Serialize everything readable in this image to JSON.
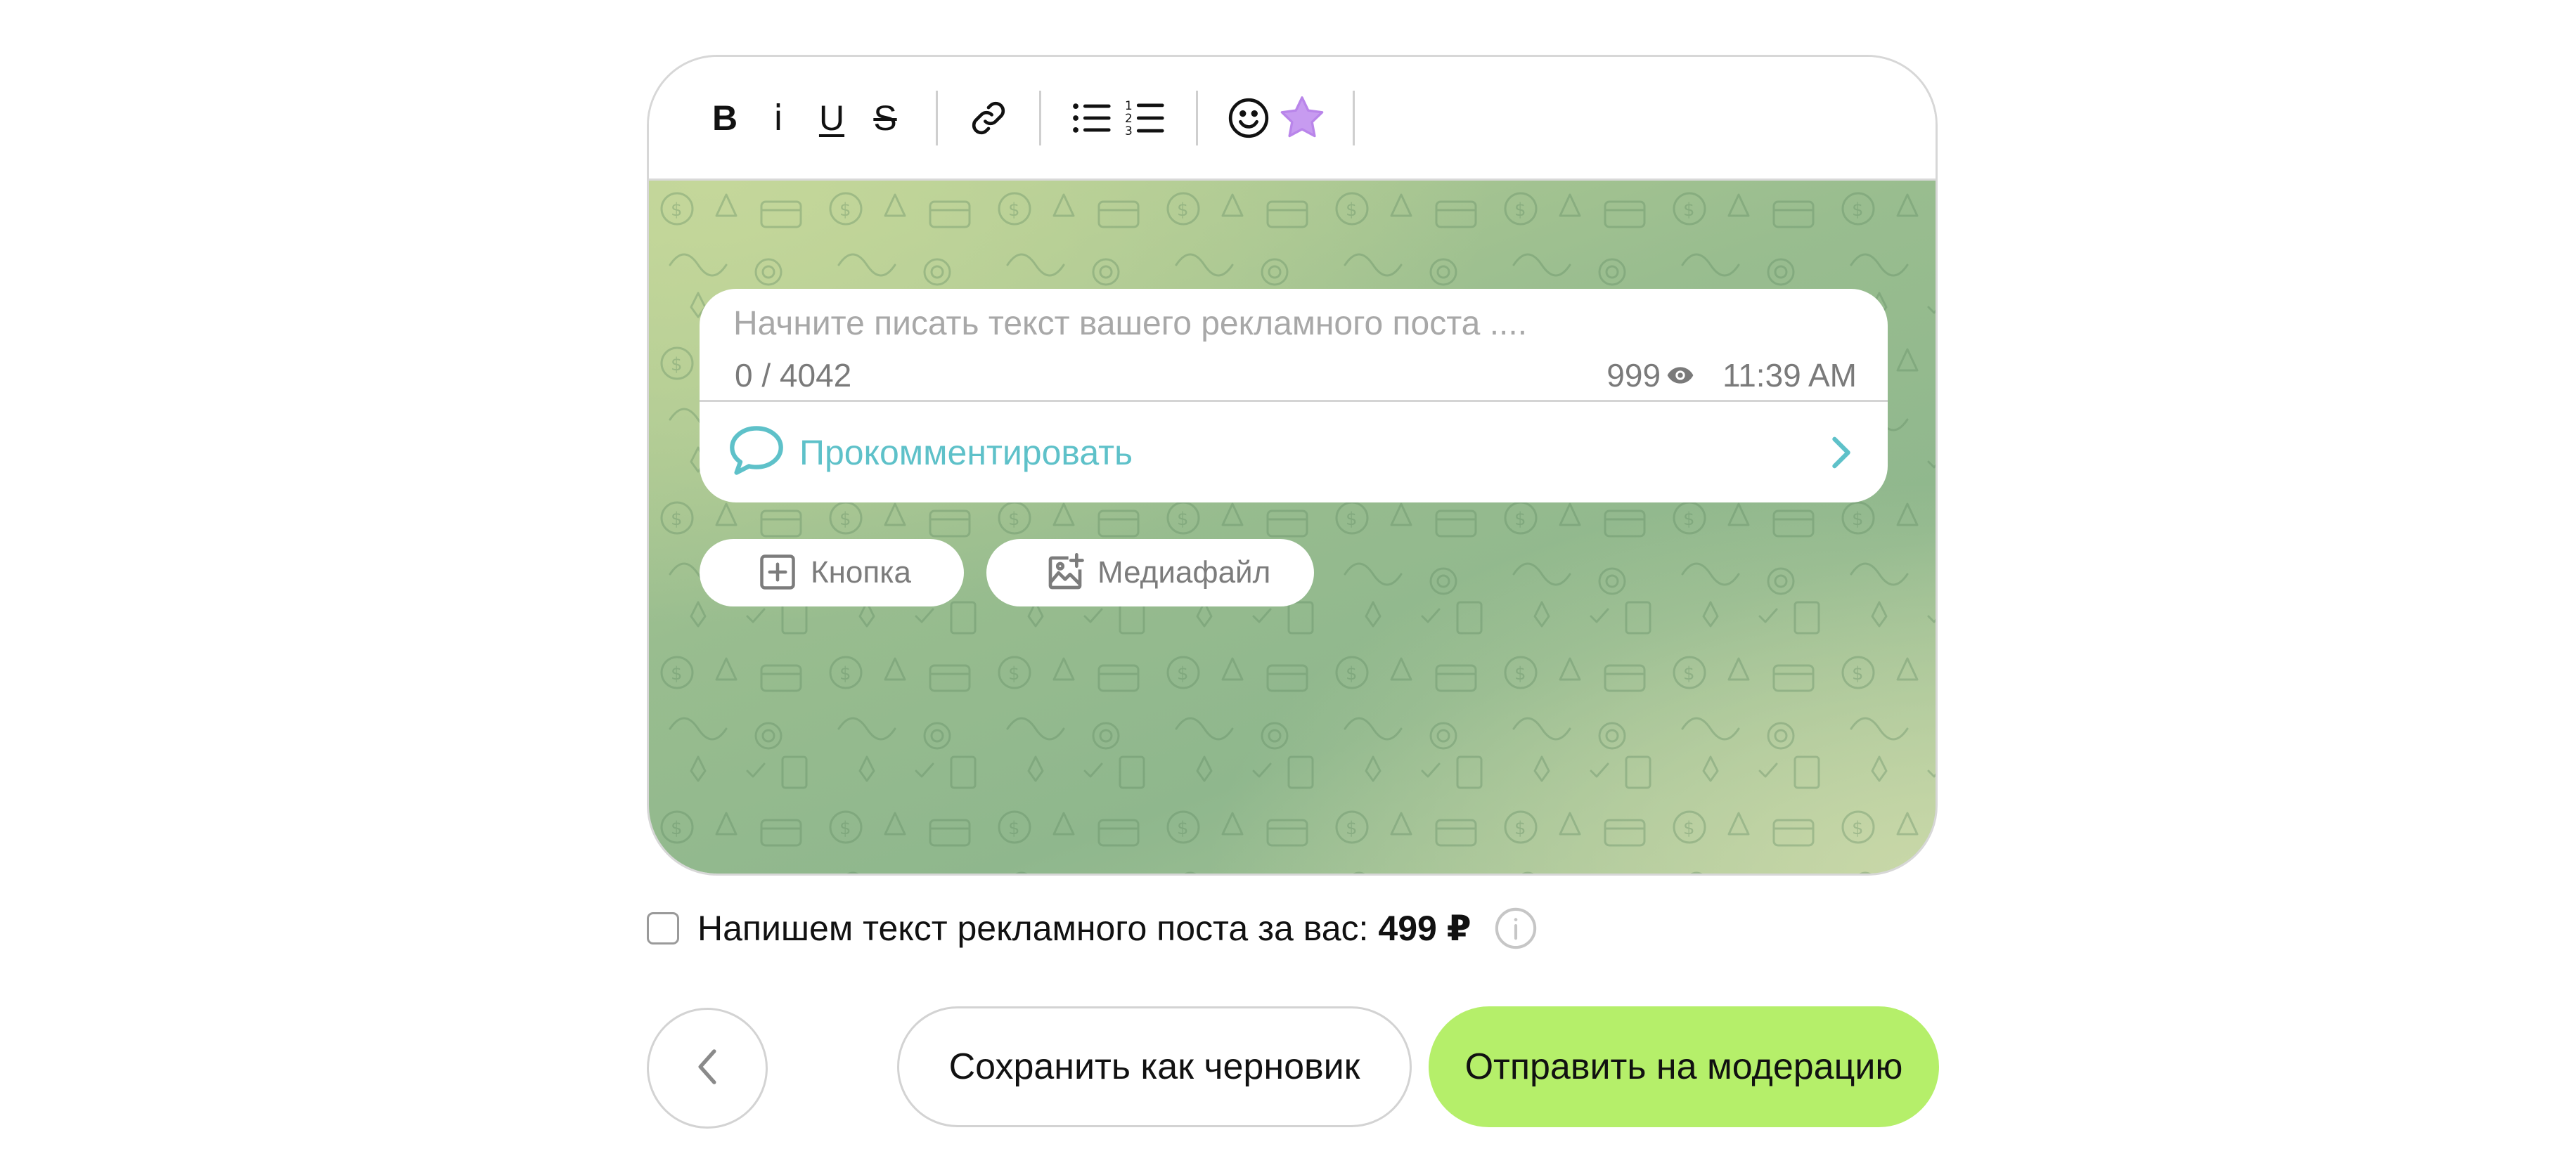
{
  "toolbar": {
    "bold_label": "B",
    "italic_label": "i",
    "underline_label": "U",
    "strike_label": "S",
    "icons": [
      "link-icon",
      "bulleted-list-icon",
      "numbered-list-icon",
      "emoji-icon",
      "premium-star-icon"
    ],
    "star_color": "#c79bf0"
  },
  "post": {
    "placeholder": "Начните писать текст вашего рекламного поста ....",
    "char_counter": "0 / 4042",
    "views": "999",
    "time": "11:39 AM",
    "comment_label": "Прокомментировать",
    "accent_color": "#5ec1c9"
  },
  "attachments": {
    "button_label": "Кнопка",
    "media_label": "Медиафайл"
  },
  "copywriting": {
    "label": "Напишем текст рекламного поста за вас:",
    "price": "499 ₽",
    "checked": false
  },
  "actions": {
    "draft_label": "Сохранить как черновик",
    "submit_label": "Отправить на модерацию",
    "submit_color": "#b5ef6a"
  }
}
